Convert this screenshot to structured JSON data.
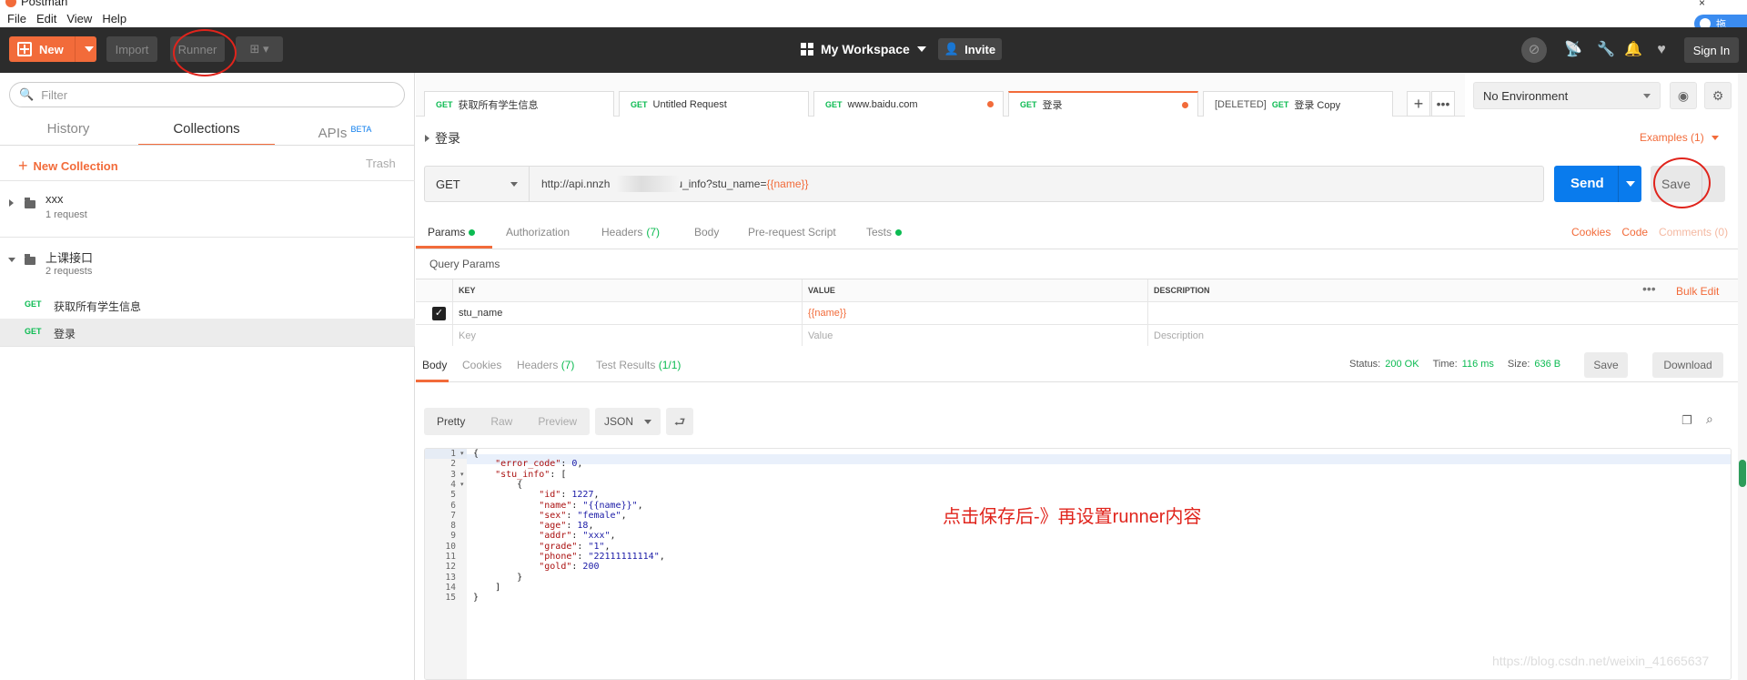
{
  "window": {
    "title": "Postman",
    "close_glyph": "×"
  },
  "menu": [
    "File",
    "Edit",
    "View",
    "Help"
  ],
  "cloud_badge": "拖",
  "header": {
    "new_label": "New",
    "import_label": "Import",
    "runner_label": "Runner",
    "workspace_label": "My Workspace",
    "invite_label": "Invite",
    "signin_label": "Sign In"
  },
  "sidebar": {
    "filter_placeholder": "Filter",
    "tabs": [
      "History",
      "Collections",
      "APIs"
    ],
    "apis_badge": "BETA",
    "new_collection": "New Collection",
    "trash": "Trash",
    "collections": [
      {
        "name": "xxx",
        "count": "1 request"
      },
      {
        "name": "上课接口",
        "count": "2 requests"
      }
    ],
    "requests": [
      {
        "method": "GET",
        "name": "获取所有学生信息"
      },
      {
        "method": "GET",
        "name": "登录"
      }
    ]
  },
  "request_tabs": [
    {
      "prefix": "",
      "method": "GET",
      "name": "获取所有学生信息"
    },
    {
      "prefix": "",
      "method": "GET",
      "name": "Untitled Request"
    },
    {
      "prefix": "",
      "method": "GET",
      "name": "www.baidu.com"
    },
    {
      "prefix": "",
      "method": "GET",
      "name": "登录"
    },
    {
      "prefix": "[DELETED]",
      "method": "GET",
      "name": "登录 Copy"
    }
  ],
  "environment": "No Environment",
  "request": {
    "name": "登录",
    "examples": "Examples (1)",
    "method": "GET",
    "url_prefix": "http://api.nnzh",
    "url_suffix": "u_info?stu_name=",
    "url_var": "{{name}}",
    "send_label": "Send",
    "save_label": "Save"
  },
  "request_subtabs": {
    "params": "Params",
    "authorization": "Authorization",
    "headers": "Headers",
    "headers_count": "(7)",
    "body": "Body",
    "prerequest": "Pre-request Script",
    "tests": "Tests",
    "cookies": "Cookies",
    "code": "Code",
    "comments": "Comments (0)"
  },
  "query_params": {
    "title": "Query Params",
    "headers": [
      "KEY",
      "VALUE",
      "DESCRIPTION"
    ],
    "bulk_edit": "Bulk Edit",
    "rows": [
      {
        "key": "stu_name",
        "value": "{{name}}",
        "description": ""
      }
    ],
    "placeholders": {
      "key": "Key",
      "value": "Value",
      "description": "Description"
    }
  },
  "response": {
    "tabs": {
      "body": "Body",
      "cookies": "Cookies",
      "headers": "Headers",
      "headers_count": "(7)",
      "tests": "Test Results",
      "tests_count": "(1/1)"
    },
    "status_label": "Status:",
    "status_value": "200 OK",
    "time_label": "Time:",
    "time_value": "116 ms",
    "size_label": "Size:",
    "size_value": "636 B",
    "save_label": "Save",
    "download_label": "Download",
    "views": [
      "Pretty",
      "Raw",
      "Preview"
    ],
    "format": "JSON"
  },
  "code_lines": [
    "{",
    "    \"error_code\": 0,",
    "    \"stu_info\": [",
    "        {",
    "            \"id\": 1227,",
    "            \"name\": \"{{name}}\",",
    "            \"sex\": \"female\",",
    "            \"age\": 18,",
    "            \"addr\": \"xxx\",",
    "            \"grade\": \"1\",",
    "            \"phone\": \"22111111114\",",
    "            \"gold\": 200",
    "        }",
    "    ]",
    "}"
  ],
  "annotation": "点击保存后-》再设置runner内容",
  "watermark": "https://blog.csdn.net/weixin_41665637",
  "colors": {
    "accent": "#f26b3a",
    "send": "#097bed",
    "get": "#0cbb52",
    "annotation": "#e0241c"
  }
}
